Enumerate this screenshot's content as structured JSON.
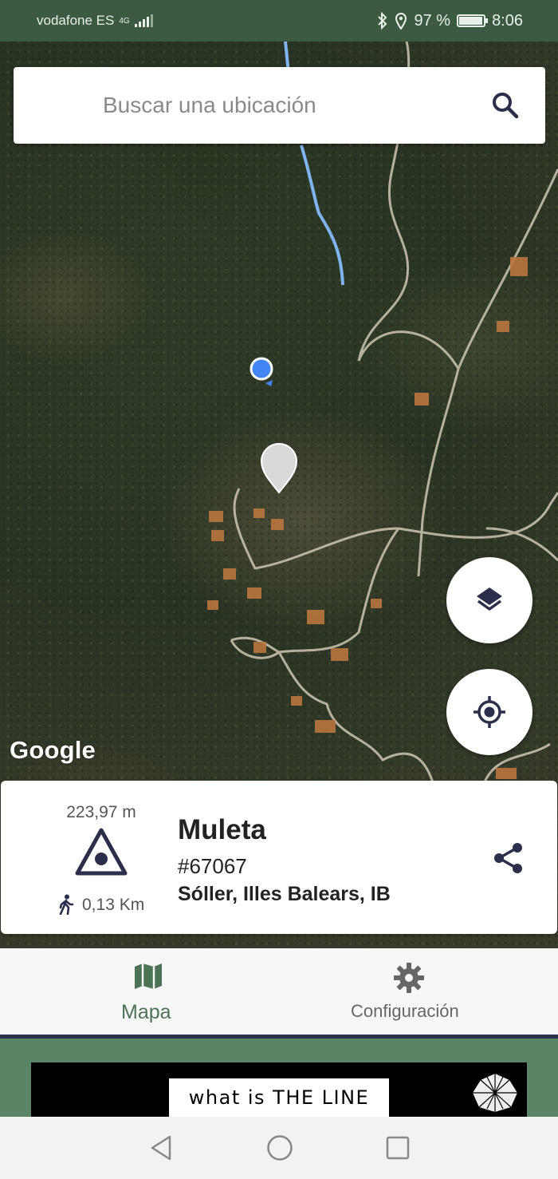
{
  "status_bar": {
    "carrier": "vodafone ES",
    "network": "4G",
    "battery_percent": "97 %",
    "battery_level": 0.97,
    "time": "8:06"
  },
  "search": {
    "placeholder": "Buscar una ubicación"
  },
  "map": {
    "attribution": "Google"
  },
  "peak": {
    "elevation": "223,97 m",
    "walk_distance": "0,13 Km",
    "name": "Muleta",
    "id": "#67067",
    "location": "Sóller, Illes Balears, IB"
  },
  "nav": {
    "map_label": "Mapa",
    "settings_label": "Configuración",
    "active": "Mapa"
  },
  "ad": {
    "text": "what is THE LINE"
  },
  "colors": {
    "status_bar": "#3c5a41",
    "accent": "#4d7357",
    "icon_dark": "#2b2f4c",
    "route_blue": "#7fb4f0"
  }
}
